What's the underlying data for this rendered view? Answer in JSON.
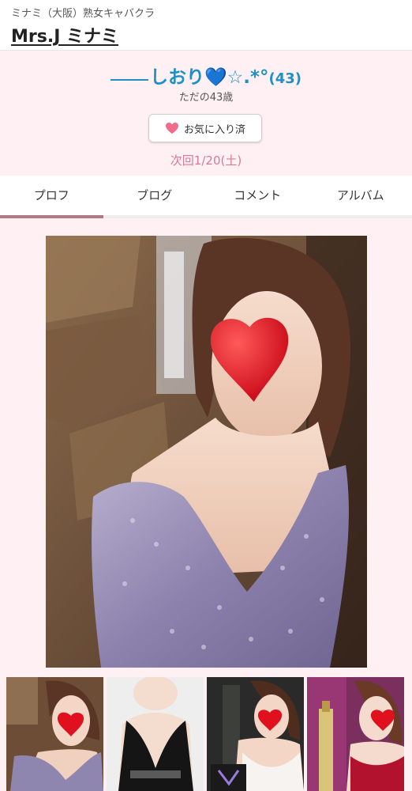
{
  "header": {
    "subtitle": "ミナミ（大阪）熟女キャバクラ",
    "title": "Mrs.J ミナミ"
  },
  "profile": {
    "name": "しおり💙☆.*°",
    "age": "(43)",
    "tagline": "ただの43歳",
    "favorite_label": "お気に入り済",
    "next_visit": "次回1/20(土)"
  },
  "tabs": [
    {
      "label": "プロフ",
      "active": true
    },
    {
      "label": "ブログ",
      "active": false
    },
    {
      "label": "コメント",
      "active": false
    },
    {
      "label": "アルバム",
      "active": false
    }
  ],
  "colors": {
    "accent_blue": "#1e90c8",
    "pink_bg": "#fff0f3",
    "next_visit": "#d87a96",
    "tab_indicator": "#b07b86"
  },
  "icons": {
    "favorite": "heart-icon"
  },
  "gallery": {
    "thumbnail_count": 4
  }
}
